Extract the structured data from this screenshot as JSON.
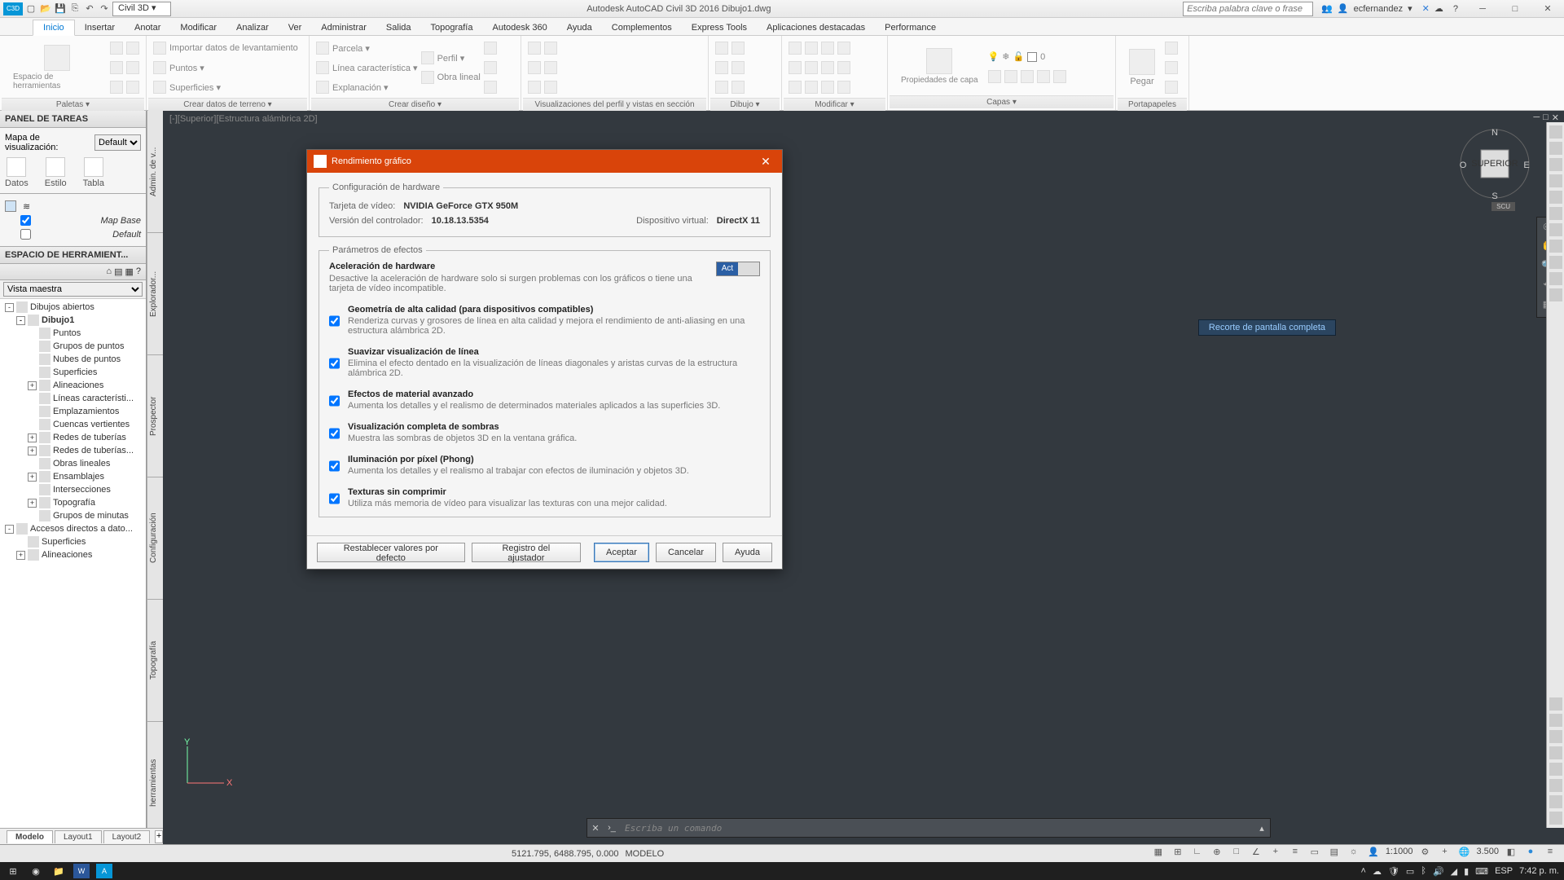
{
  "titlebar": {
    "workspace": "Civil 3D",
    "app_title": "Autodesk AutoCAD Civil 3D 2016   Dibujo1.dwg",
    "search_placeholder": "Escriba palabra clave o frase",
    "user": "ecfernandez"
  },
  "ribbon_tabs": [
    "Inicio",
    "Insertar",
    "Anotar",
    "Modificar",
    "Analizar",
    "Ver",
    "Administrar",
    "Salida",
    "Topografía",
    "Autodesk 360",
    "Ayuda",
    "Complementos",
    "Express Tools",
    "Aplicaciones destacadas",
    "Performance"
  ],
  "ribbon_active": "Inicio",
  "ribbon_panels": {
    "paletas": {
      "title": "Paletas ▾",
      "big": "Espacio de herramientas"
    },
    "terreno": {
      "title": "Crear datos de terreno ▾",
      "items": [
        "Importar datos de levantamiento",
        "Puntos ▾",
        "Superficies ▾"
      ]
    },
    "diseno": {
      "title": "Crear diseño ▾",
      "items": [
        "Parcela ▾",
        "Línea característica ▾",
        "Explanación ▾",
        "Perfil ▾",
        "Obra lineal"
      ]
    },
    "perfil": {
      "title": "Visualizaciones del perfil y vistas en sección"
    },
    "dibujo": {
      "title": "Dibujo ▾"
    },
    "modificar": {
      "title": "Modificar ▾"
    },
    "capas": {
      "title": "Capas ▾",
      "props": "Propiedades de capa",
      "value": "0"
    },
    "portapapeles": {
      "title": "Portapapeles",
      "paste": "Pegar"
    }
  },
  "panel_tareas": {
    "title": "PANEL DE TAREAS",
    "mapa_label": "Mapa de visualización:",
    "mapa_value": "Default",
    "cols": [
      "Datos",
      "Estilo",
      "Tabla"
    ],
    "layers": [
      {
        "checked": true,
        "name": "Map Base"
      },
      {
        "checked": false,
        "name": "Default"
      }
    ]
  },
  "toolspace": {
    "title": "ESPACIO DE HERRAMIENT...",
    "view": "Vista maestra",
    "vtabs": [
      "Admin. de v...",
      "Explorador...",
      "Prospector",
      "Configuración",
      "Topografía",
      "herramientas"
    ],
    "tree": [
      {
        "l": 1,
        "exp": "-",
        "label": "Dibujos abiertos"
      },
      {
        "l": 2,
        "exp": "-",
        "label": "Dibujo1",
        "bold": true
      },
      {
        "l": 3,
        "label": "Puntos"
      },
      {
        "l": 3,
        "label": "Grupos de puntos"
      },
      {
        "l": 3,
        "label": "Nubes de puntos"
      },
      {
        "l": 3,
        "label": "Superficies"
      },
      {
        "l": 3,
        "exp": "+",
        "label": "Alineaciones"
      },
      {
        "l": 3,
        "label": "Líneas característi..."
      },
      {
        "l": 3,
        "label": "Emplazamientos"
      },
      {
        "l": 3,
        "label": "Cuencas vertientes"
      },
      {
        "l": 3,
        "exp": "+",
        "label": "Redes de tuberías"
      },
      {
        "l": 3,
        "exp": "+",
        "label": "Redes de tuberías..."
      },
      {
        "l": 3,
        "label": "Obras lineales"
      },
      {
        "l": 3,
        "exp": "+",
        "label": "Ensamblajes"
      },
      {
        "l": 3,
        "label": "Intersecciones"
      },
      {
        "l": 3,
        "exp": "+",
        "label": "Topografía"
      },
      {
        "l": 3,
        "label": "Grupos de minutas"
      },
      {
        "l": 1,
        "exp": "-",
        "label": "Accesos directos a dato..."
      },
      {
        "l": 2,
        "label": "Superficies"
      },
      {
        "l": 2,
        "exp": "+",
        "label": "Alineaciones"
      }
    ]
  },
  "canvas": {
    "viewport_label": "[-][Superior][Estructura alámbrica 2D]",
    "cmd_placeholder": "Escriba un comando",
    "hint": "Recorte de pantalla completa",
    "viewcube": {
      "n": "N",
      "s": "S",
      "e": "E",
      "w": "O",
      "face": "SUPERIOR",
      "scu": "SCU"
    }
  },
  "dialog": {
    "title": "Rendimiento gráfico",
    "hw": {
      "legend": "Configuración de hardware",
      "card_lbl": "Tarjeta de vídeo:",
      "card_val": "NVIDIA GeForce GTX 950M",
      "driver_lbl": "Versión del controlador:",
      "driver_val": "10.18.13.5354",
      "virtual_lbl": "Dispositivo virtual:",
      "virtual_val": "DirectX 11"
    },
    "effects": {
      "legend": "Parámetros de efectos",
      "accel_title": "Aceleración de hardware",
      "accel_desc": "Desactive la aceleración de hardware solo si surgen problemas con los gráficos o tiene una tarjeta de vídeo incompatible.",
      "toggle_on": "Act"
    },
    "opts": [
      {
        "title": "Geometría de alta calidad (para dispositivos compatibles)",
        "desc": "Renderiza curvas y grosores de línea en alta calidad  y mejora el rendimiento de anti-aliasing en una estructura alámbrica 2D."
      },
      {
        "title": "Suavizar visualización de línea",
        "desc": "Elimina el efecto dentado en la visualización de líneas diagonales y aristas curvas de la estructura alámbrica 2D."
      },
      {
        "title": "Efectos de material avanzado",
        "desc": "Aumenta los detalles y el realismo de determinados materiales aplicados a las superficies 3D."
      },
      {
        "title": "Visualización completa de sombras",
        "desc": "Muestra las sombras de objetos 3D en la ventana gráfica."
      },
      {
        "title": "Iluminación por píxel (Phong)",
        "desc": "Aumenta los detalles y el realismo al trabajar con efectos de iluminación y objetos 3D."
      },
      {
        "title": "Texturas sin comprimir",
        "desc": "Utiliza más memoria de vídeo para visualizar las texturas con una mejor calidad."
      }
    ],
    "btn_reset": "Restablecer valores por defecto",
    "btn_tuner": "Registro del ajustador",
    "btn_ok": "Aceptar",
    "btn_cancel": "Cancelar",
    "btn_help": "Ayuda"
  },
  "bottom_tabs": [
    "Modelo",
    "Layout1",
    "Layout2"
  ],
  "status": {
    "coords": "5121.795, 6488.795, 0.000",
    "space": "MODELO",
    "scale": "1:1000",
    "deg": "3.500"
  },
  "taskbar": {
    "lang": "ESP",
    "clock": "7:42 p. m."
  }
}
